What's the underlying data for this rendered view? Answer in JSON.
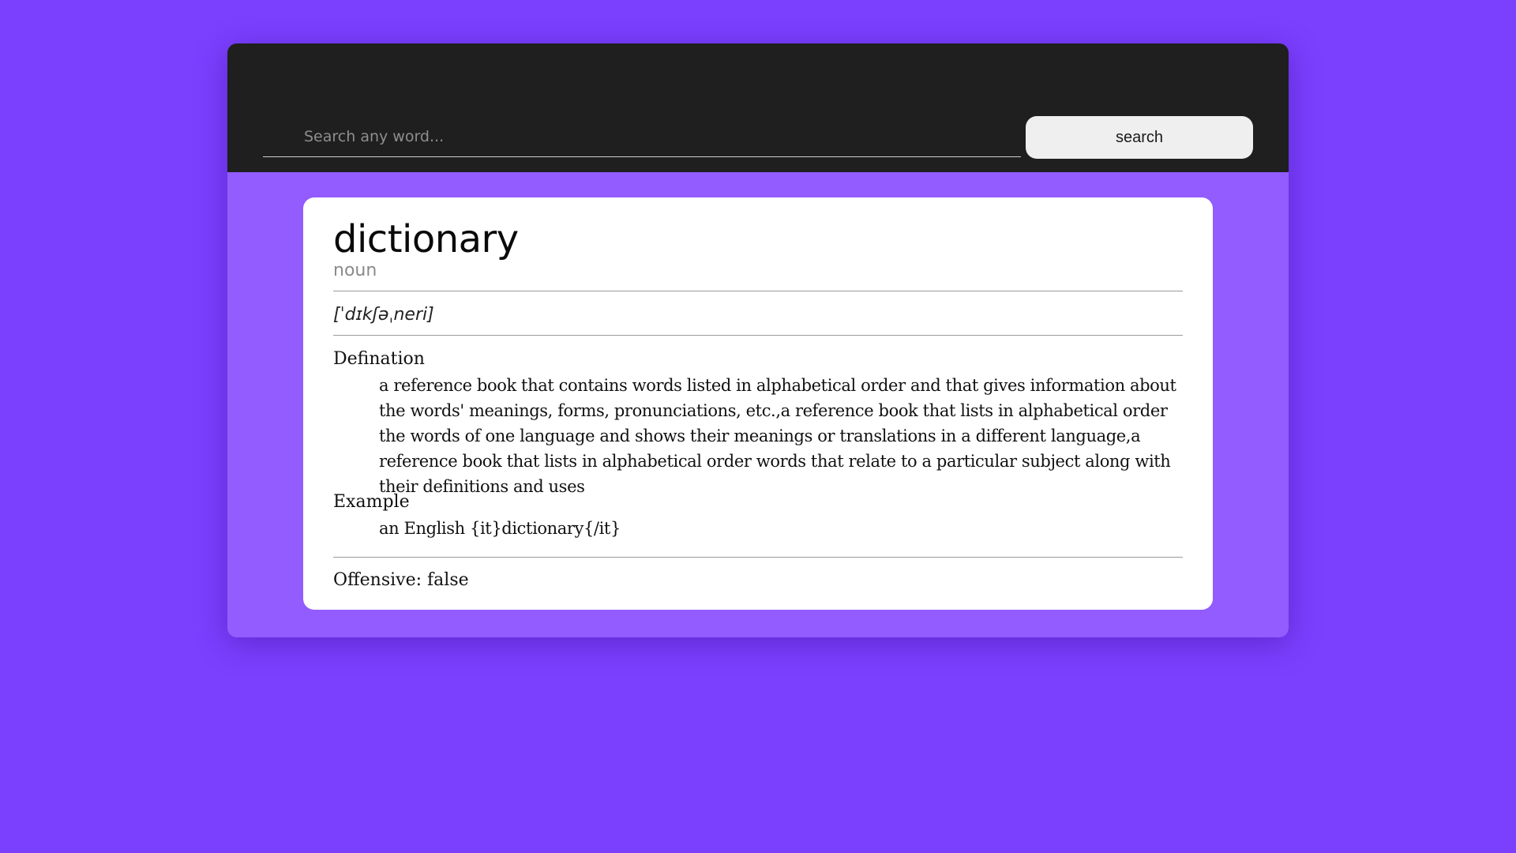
{
  "search": {
    "placeholder": "Search any word...",
    "value": "",
    "button_label": "search"
  },
  "entry": {
    "word": "dictionary",
    "part_of_speech": "noun",
    "pronunciation": "[ˈdɪkʃəˌneri]",
    "definition_label": "Defination",
    "definition": "a reference book that contains words listed in alphabetical order and that gives information about the words' meanings, forms, pronunciations, etc.,a reference book that lists in alphabetical order the words of one language and shows their meanings or translations in a different language,a reference book that lists in alphabetical order words that relate to a particular subject along with their definitions and uses",
    "example_label": "Example",
    "example": "an English {it}dictionary{/it}",
    "offensive": "Offensive: false"
  },
  "colors": {
    "background": "#7b3ffe",
    "panel": "#925cff",
    "header": "#1f1f1f",
    "card": "#ffffff"
  }
}
